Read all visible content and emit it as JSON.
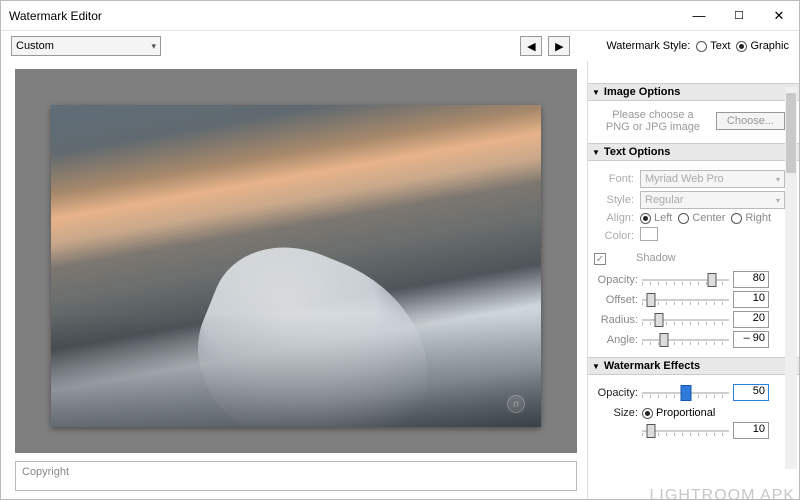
{
  "window": {
    "title": "Watermark Editor"
  },
  "toolbar": {
    "preset": "Custom",
    "style_label": "Watermark Style:",
    "style_text": "Text",
    "style_graphic": "Graphic",
    "style_selected": "Graphic"
  },
  "preview": {
    "watermark_badge": "n"
  },
  "copyright": {
    "placeholder": "Copyright"
  },
  "panels": {
    "image_options": {
      "title": "Image Options",
      "hint_line1": "Please choose a",
      "hint_line2": "PNG or JPG image",
      "choose_btn": "Choose..."
    },
    "text_options": {
      "title": "Text Options",
      "font_label": "Font:",
      "font_value": "Myriad Web Pro",
      "style_label": "Style:",
      "style_value": "Regular",
      "align_label": "Align:",
      "align_left": "Left",
      "align_center": "Center",
      "align_right": "Right",
      "align_selected": "Left",
      "color_label": "Color:",
      "shadow": {
        "title": "Shadow",
        "opacity_label": "Opacity:",
        "opacity_value": 80,
        "offset_label": "Offset:",
        "offset_value": 10,
        "radius_label": "Radius:",
        "radius_value": 20,
        "angle_label": "Angle:",
        "angle_value": "– 90"
      }
    },
    "effects": {
      "title": "Watermark Effects",
      "opacity_label": "Opacity:",
      "opacity_value": 50,
      "size_label": "Size:",
      "size_proportional": "Proportional",
      "size_value": 10
    }
  },
  "branding": {
    "footer": "LIGHTROOM APK"
  }
}
